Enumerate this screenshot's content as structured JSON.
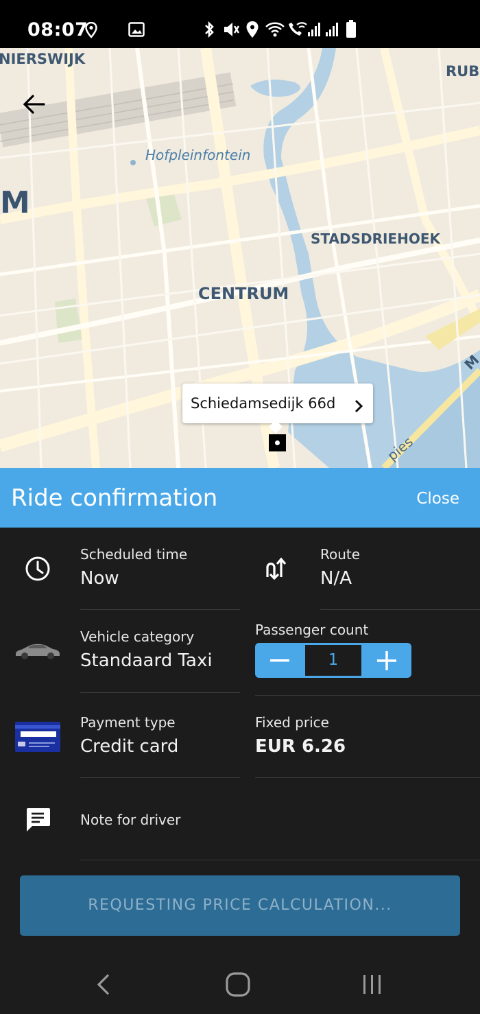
{
  "status_bar": {
    "time": "08:07",
    "icons": [
      "location-icon",
      "image-icon",
      "bluetooth-icon",
      "mute-icon",
      "location-icon",
      "wifi-icon",
      "wifi-call-icon",
      "signal-icon",
      "signal-icon",
      "battery-icon"
    ]
  },
  "map": {
    "labels": {
      "nierswijk": "NIERSWIJK",
      "rubr": "RUBR",
      "hofplein": "Hofpleinfontein",
      "m": "M",
      "stadsdriehoek": "STADSDRIEHOEK",
      "centrum": "CENTRUM",
      "pies": "pies",
      "edge_m": "M"
    },
    "address": "Schiedamsedijk 66d"
  },
  "header": {
    "title": "Ride confirmation",
    "close_label": "Close"
  },
  "details": {
    "scheduled_time": {
      "label": "Scheduled time",
      "value": "Now"
    },
    "route": {
      "label": "Route",
      "value": "N/A"
    },
    "vehicle_category": {
      "label": "Vehicle category",
      "value": "Standaard Taxi"
    },
    "passenger_count": {
      "label": "Passenger count",
      "value": "1"
    },
    "payment_type": {
      "label": "Payment type",
      "value": "Credit card"
    },
    "fixed_price": {
      "label": "Fixed price",
      "value": "EUR 6.26"
    },
    "note": {
      "label": "Note for driver"
    }
  },
  "request_button": "REQUESTING PRICE CALCULATION...",
  "colors": {
    "accent": "#4aa8e8",
    "panel": "#1c1c1c",
    "button": "#2d6c95"
  }
}
